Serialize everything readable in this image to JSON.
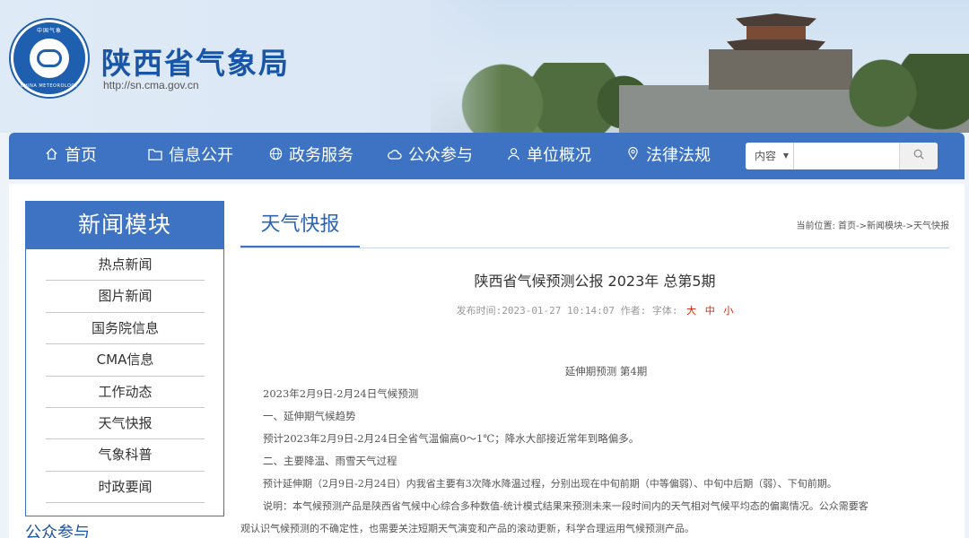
{
  "header": {
    "logo_ring_top": "中国气象",
    "logo_ring_bottom": "CHINA METEOROLOGY",
    "title": "陕西省气象局",
    "url": "http://sn.cma.gov.cn"
  },
  "nav": {
    "items": [
      {
        "label": "首页",
        "icon": "home-icon"
      },
      {
        "label": "信息公开",
        "icon": "folder-icon"
      },
      {
        "label": "政务服务",
        "icon": "globe-icon"
      },
      {
        "label": "公众参与",
        "icon": "cloud-icon"
      },
      {
        "label": "单位概况",
        "icon": "user-icon"
      },
      {
        "label": "法律法规",
        "icon": "location-icon"
      }
    ],
    "search": {
      "select_value": "内容",
      "placeholder": ""
    }
  },
  "sidebar": {
    "title": "新闻模块",
    "items": [
      "热点新闻",
      "图片新闻",
      "国务院信息",
      "CMA信息",
      "工作动态",
      "天气快报",
      "气象科普",
      "时政要闻"
    ],
    "next_section": "公众参与"
  },
  "main": {
    "tab": "天气快报",
    "breadcrumb": "当前位置: 首页->新闻模块->天气快报",
    "article": {
      "title": "陕西省气候预测公报 2023年 总第5期",
      "meta": "发布时间:2023-01-27 10:14:07 作者: 字体:",
      "font_sizes": [
        "大",
        "中",
        "小"
      ],
      "paragraphs": [
        "延伸期预测 第4期",
        "2023年2月9日-2月24日气候预测",
        "一、延伸期气候趋势",
        "预计2023年2月9日-2月24日全省气温偏高0～1℃；降水大部接近常年到略偏多。",
        "二、主要降温、雨雪天气过程",
        "预计延伸期（2月9日-2月24日）内我省主要有3次降水降温过程，分别出现在中旬前期（中等偏弱）、中旬中后期（弱）、下旬前期。",
        "说明：本气候预测产品是陕西省气候中心综合多种数值-统计模式结果来预测未来一段时间内的天气相对气候平均态的偏离情况。公众需要客",
        "观认识气候预测的不确定性，也需要关注短期天气演变和产品的滚动更新，科学合理运用气候预测产品。"
      ]
    }
  },
  "colors": {
    "primary": "#3e73c4",
    "title_blue": "#1a56a8",
    "font_size_red": "#d81e06"
  }
}
